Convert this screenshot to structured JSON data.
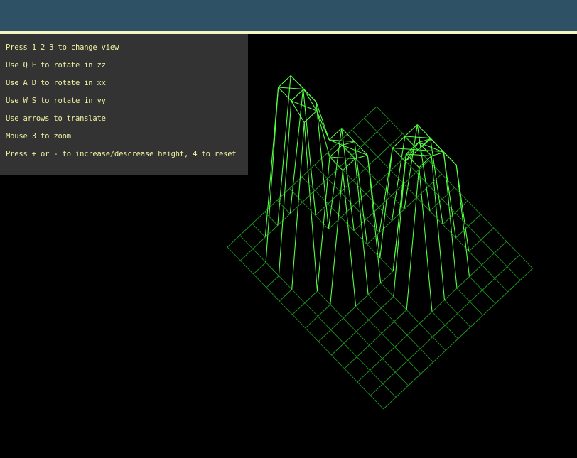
{
  "colors": {
    "titlebar": "#2e5166",
    "accent_line": "#f4f4c0",
    "panel_bg": "#333333",
    "help_text": "#f0f0a0",
    "wire_grid": "#1f9a1f",
    "wire_bright": "#55ff44",
    "background": "#000000"
  },
  "help": {
    "lines": [
      "Press 1 2 3 to change view",
      "Use Q E to rotate in zz",
      "Use A D to rotate in xx",
      "Use W S to rotate in yy",
      "Use arrows to translate",
      "Mouse 3 to zoom",
      "Press + or - to increase/descrease height, 4 to reset"
    ]
  },
  "scene": {
    "grid_size": 12,
    "peaks": [
      {
        "row": 2,
        "col": 2,
        "height": 1.0
      },
      {
        "row": 2,
        "col": 3,
        "height": 0.95
      },
      {
        "row": 3,
        "col": 2,
        "height": 0.85
      },
      {
        "row": 3,
        "col": 5,
        "height": 0.75
      },
      {
        "row": 4,
        "col": 4,
        "height": 0.7
      },
      {
        "row": 4,
        "col": 5,
        "height": 0.7
      },
      {
        "row": 6,
        "col": 8,
        "height": 0.8
      },
      {
        "row": 7,
        "col": 8,
        "height": 0.75
      },
      {
        "row": 7,
        "col": 6,
        "height": 0.6
      },
      {
        "row": 8,
        "col": 6,
        "height": 0.6
      },
      {
        "row": 8,
        "col": 7,
        "height": 0.6
      },
      {
        "row": 8,
        "col": 8,
        "height": 0.6
      }
    ]
  }
}
